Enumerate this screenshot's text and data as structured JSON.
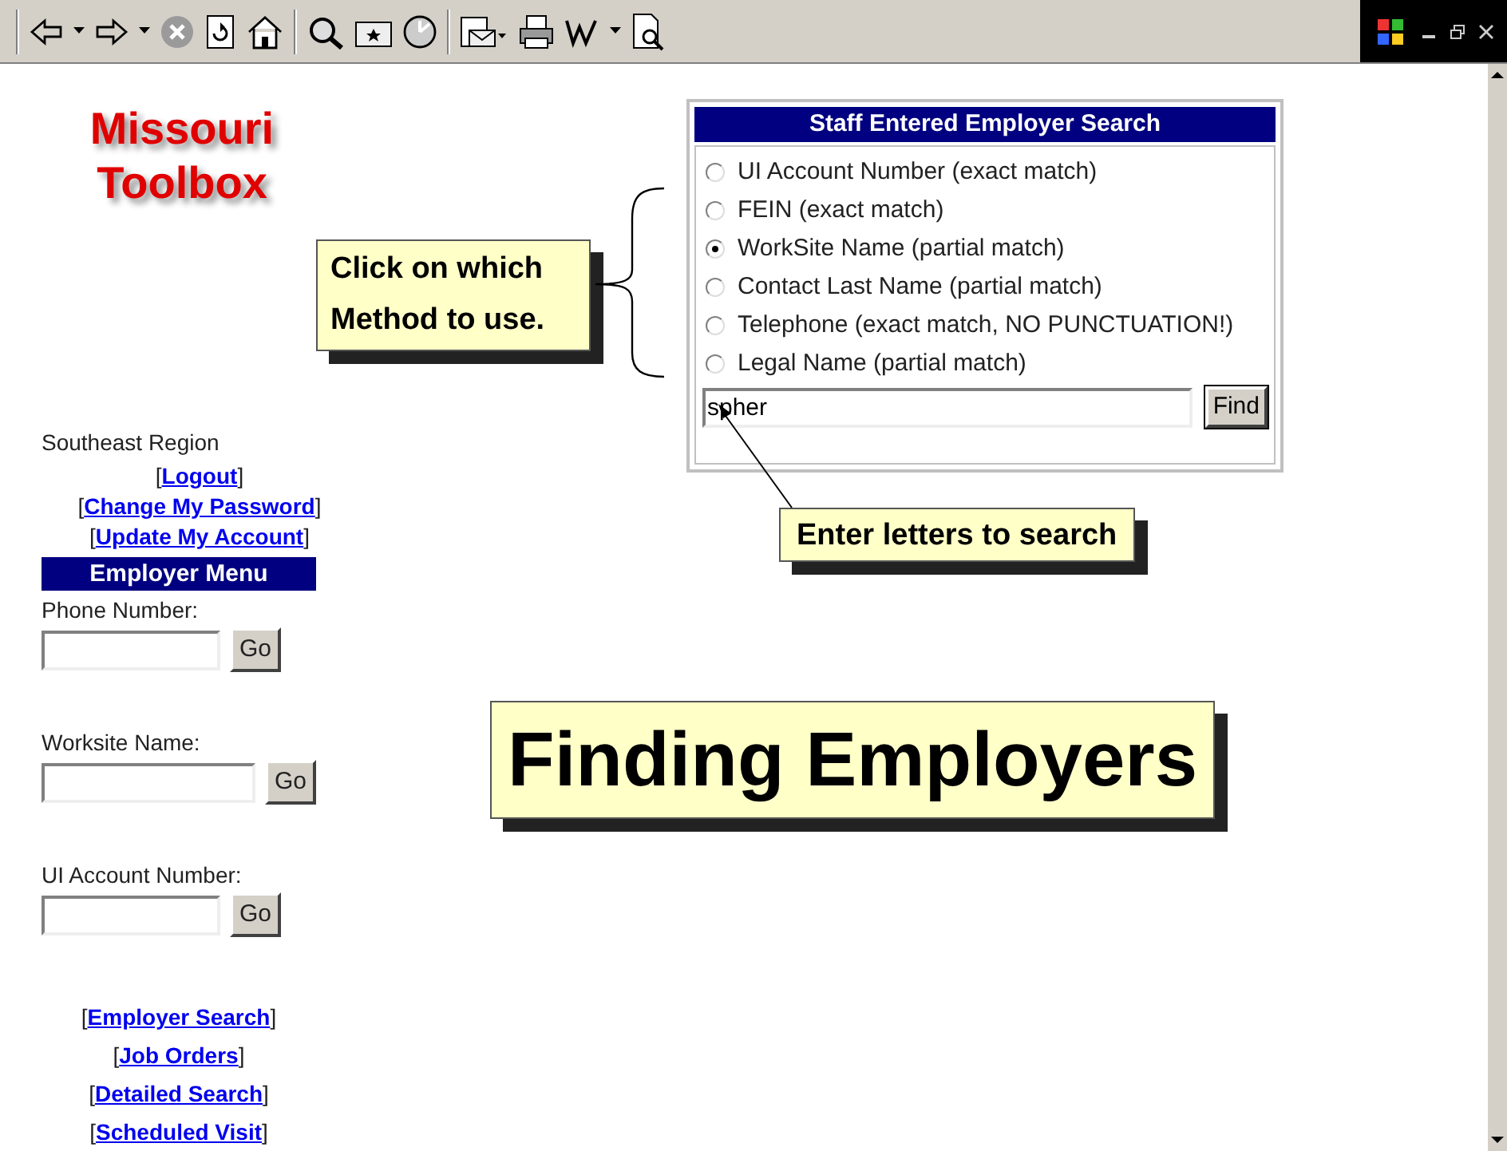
{
  "logo": {
    "line_1": "Missouri",
    "line_2": "Toolbox"
  },
  "sidebar": {
    "region": "Southeast Region",
    "account_links": [
      {
        "open": "[",
        "label": "Logout",
        "close": "]"
      },
      {
        "open": "[",
        "label": "Change My Password",
        "close": "]"
      },
      {
        "open": "[",
        "label": "Update My Account",
        "close": "]"
      }
    ],
    "menu_title": "Employer Menu",
    "quick_searches": [
      {
        "label": "Phone Number:",
        "button": "Go",
        "wide": false
      },
      {
        "label": "Worksite Name:",
        "button": "Go",
        "wide": true
      },
      {
        "label": "UI Account Number:",
        "button": "Go",
        "wide": false
      }
    ],
    "menu_links": [
      {
        "open": "[",
        "label": "Employer Search",
        "close": "]"
      },
      {
        "open": "[",
        "label": "Job Orders",
        "close": "]"
      },
      {
        "open": "[",
        "label": "Detailed Search",
        "close": "]"
      },
      {
        "open": "[",
        "label": "Scheduled Visit",
        "close": "]"
      }
    ]
  },
  "search_panel": {
    "title": "Staff Entered Employer Search",
    "options": [
      {
        "label": "UI Account Number (exact match)",
        "selected": false
      },
      {
        "label": "FEIN (exact match)",
        "selected": false
      },
      {
        "label": "WorkSite Name (partial match)",
        "selected": true
      },
      {
        "label": "Contact Last Name (partial match)",
        "selected": false
      },
      {
        "label": "Telephone (exact match, NO PUNCTUATION!)",
        "selected": false
      },
      {
        "label": "Legal Name (partial match)",
        "selected": false
      }
    ],
    "search_value": "spher",
    "find_button": "Find"
  },
  "callouts": [
    {
      "text": "Click on which Method to use."
    },
    {
      "text": "Enter letters to search"
    }
  ],
  "headline": "Finding Employers"
}
